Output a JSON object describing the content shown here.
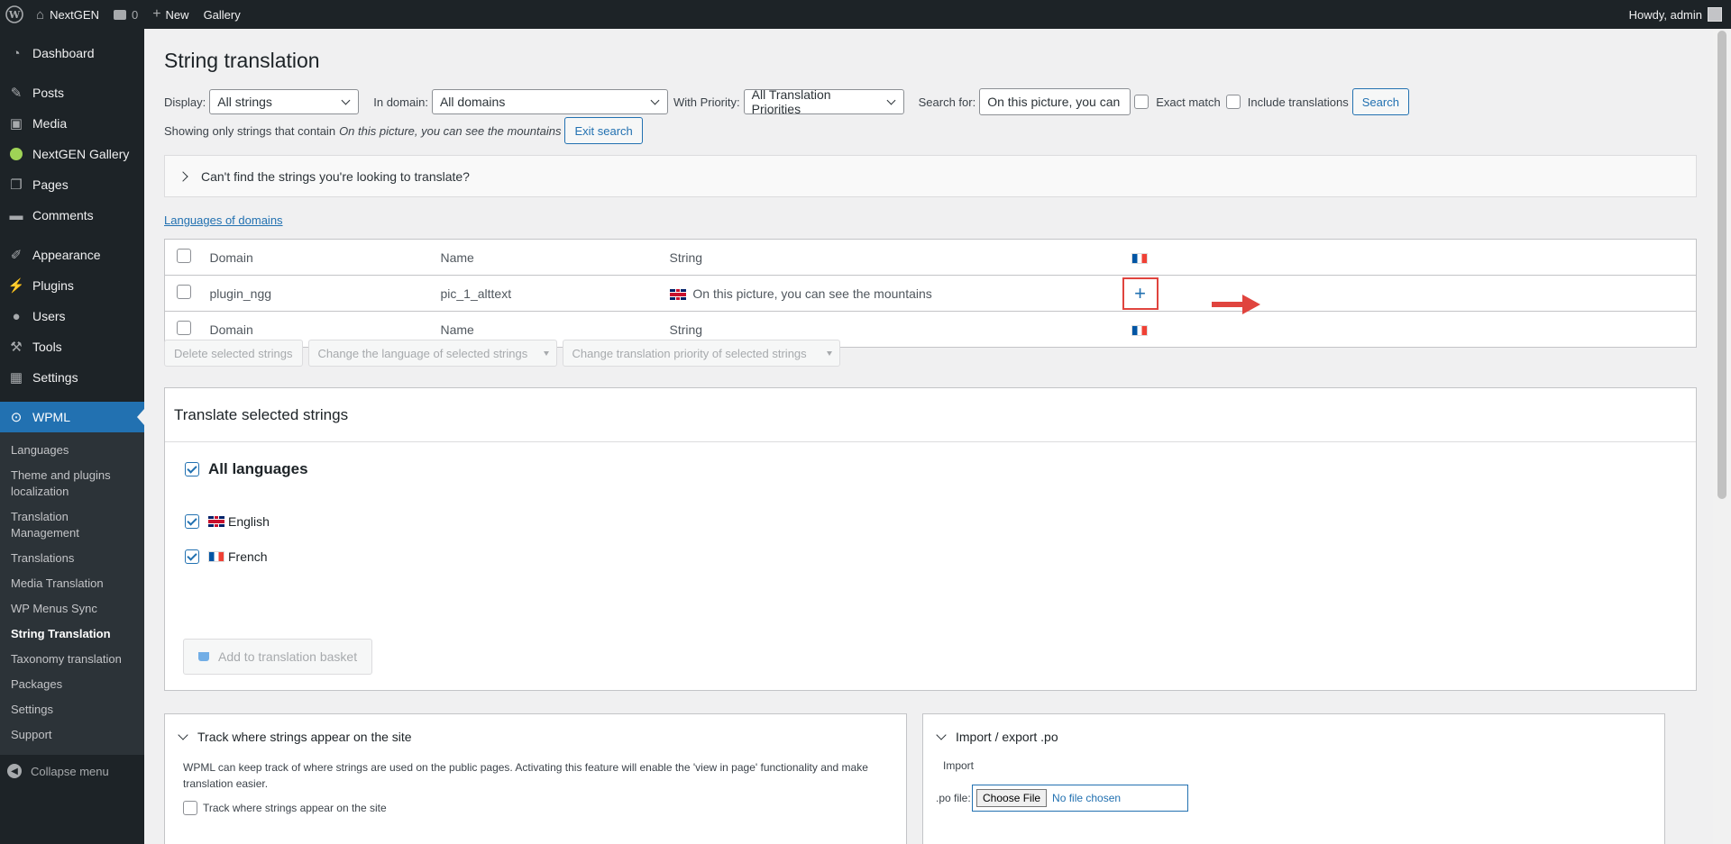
{
  "adminbar": {
    "site_name": "NextGEN",
    "comments_count": "0",
    "new_label": "New",
    "gallery_label": "Gallery",
    "howdy": "Howdy, admin"
  },
  "sidebar": {
    "items": [
      {
        "label": "Dashboard",
        "icon": "dashboard-icon"
      },
      {
        "label": "Posts",
        "icon": "pin-icon"
      },
      {
        "label": "Media",
        "icon": "media-icon"
      },
      {
        "label": "NextGEN Gallery",
        "icon": "nextgen-icon"
      },
      {
        "label": "Pages",
        "icon": "pages-icon"
      },
      {
        "label": "Comments",
        "icon": "comments-icon"
      },
      {
        "label": "Appearance",
        "icon": "brush-icon"
      },
      {
        "label": "Plugins",
        "icon": "plugin-icon"
      },
      {
        "label": "Users",
        "icon": "user-icon"
      },
      {
        "label": "Tools",
        "icon": "wrench-icon"
      },
      {
        "label": "Settings",
        "icon": "settings-icon"
      },
      {
        "label": "WPML",
        "icon": "wpml-icon"
      }
    ],
    "submenu": [
      "Languages",
      "Theme and plugins localization",
      "Translation Management",
      "Translations",
      "Media Translation",
      "WP Menus Sync",
      "String Translation",
      "Taxonomy translation",
      "Packages",
      "Settings",
      "Support"
    ],
    "collapse_label": "Collapse menu"
  },
  "page": {
    "title": "String translation",
    "display_label": "Display:",
    "display_value": "All strings",
    "domain_label": "In domain:",
    "domain_value": "All domains",
    "priority_label": "With Priority:",
    "priority_value": "All Translation Priorities",
    "search_label": "Search for:",
    "search_value": "On this picture, you can",
    "exact_match": "Exact match",
    "include_translations": "Include translations",
    "search_button": "Search",
    "showing_prefix": "Showing only strings that contain",
    "showing_term": "On this picture, you can see the mountains",
    "exit_search": "Exit search",
    "cant_find": "Can't find the strings you're looking to translate?",
    "languages_of_domains": "Languages of domains"
  },
  "table": {
    "headers": {
      "domain": "Domain",
      "name": "Name",
      "string": "String"
    },
    "row": {
      "domain": "plugin_ngg",
      "name": "pic_1_alttext",
      "string": "On this picture, you can see the mountains"
    },
    "plus": "+"
  },
  "bulk": {
    "delete": "Delete selected strings",
    "change_language": "Change the language of selected strings",
    "change_priority": "Change translation priority of selected strings"
  },
  "translate": {
    "title": "Translate selected strings",
    "all_languages": "All languages",
    "english": "English",
    "french": "French",
    "basket": "Add to translation basket"
  },
  "track": {
    "title": "Track where strings appear on the site",
    "description": "WPML can keep track of where strings are used on the public pages. Activating this feature will enable the 'view in page' functionality and make translation easier.",
    "checkbox_label": "Track where strings appear on the site"
  },
  "import": {
    "title": "Import / export .po",
    "import_label": "Import",
    "file_label": ".po file:",
    "choose_file": "Choose File",
    "no_file": "No file chosen"
  },
  "colors": {
    "accent": "#2271b1",
    "highlight": "#e0443e",
    "sidebar": "#1d2327"
  }
}
